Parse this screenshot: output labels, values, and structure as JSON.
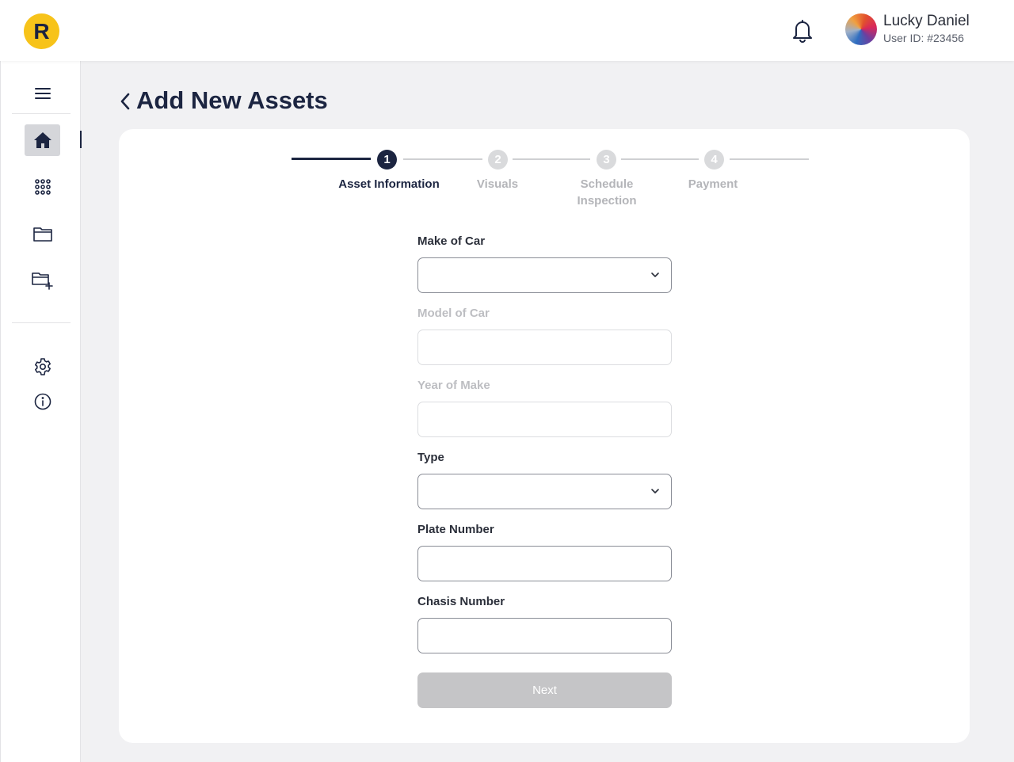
{
  "header": {
    "logo_letter": "R",
    "user": {
      "name": "Lucky Daniel",
      "id_label": "User ID: #23456"
    }
  },
  "sidebar": {
    "items": [
      {
        "icon": "menu-icon"
      },
      {
        "icon": "home-icon",
        "active": true
      },
      {
        "icon": "apps-grid-icon"
      },
      {
        "icon": "folder-icon"
      },
      {
        "icon": "folder-add-icon"
      },
      {
        "icon": "settings-icon"
      },
      {
        "icon": "info-icon"
      }
    ]
  },
  "page": {
    "title": "Add New Assets"
  },
  "stepper": {
    "steps": [
      {
        "number": "1",
        "label": "Asset Information",
        "status": "active"
      },
      {
        "number": "2",
        "label": "Visuals",
        "status": "inactive"
      },
      {
        "number": "3",
        "label_line1": "Schedule",
        "label_line2": "Inspection",
        "status": "inactive"
      },
      {
        "number": "4",
        "label": "Payment",
        "status": "inactive"
      }
    ]
  },
  "form": {
    "make": {
      "label": "Make of Car",
      "value": "",
      "type": "select"
    },
    "model": {
      "label": "Model of Car",
      "value": "",
      "type": "text",
      "disabled": true
    },
    "year": {
      "label": "Year of Make",
      "value": "",
      "type": "text",
      "disabled": true
    },
    "type": {
      "label": "Type",
      "value": "",
      "type": "select"
    },
    "plate": {
      "label": "Plate Number",
      "value": "",
      "type": "text"
    },
    "chassis": {
      "label": "Chasis Number",
      "value": "",
      "type": "text"
    },
    "next_label": "Next"
  },
  "colors": {
    "primary": "#1c2541",
    "accent": "#f7c31a",
    "disabled": "#c5c5c7",
    "background": "#f1f1f3"
  }
}
